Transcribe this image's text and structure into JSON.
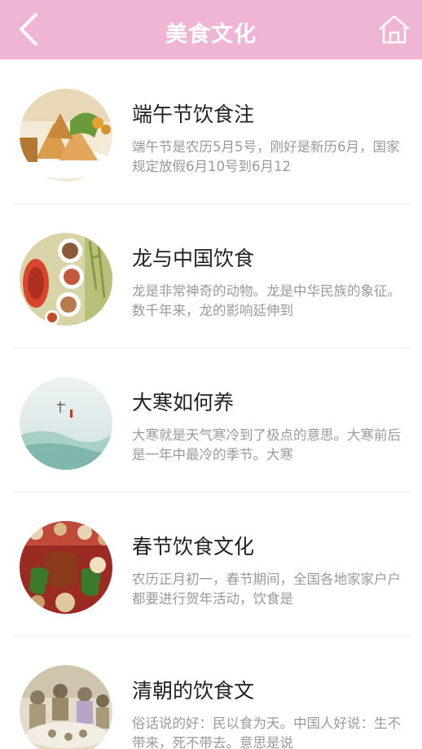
{
  "header": {
    "title": "美食文化",
    "back_icon": "chevron-left-icon",
    "home_icon": "home-icon",
    "background": "#f0b4d4"
  },
  "articles": [
    {
      "title": "端午节饮食注",
      "description": "端午节是农历5月5号，刚好是新历6月，国家规定放假6月10号到6月12",
      "thumbnail": "zongzi-food-photo"
    },
    {
      "title": "龙与中国饮食",
      "description": "龙是非常神奇的动物。龙是中华民族的象征。数千年来，龙的影响延伸到",
      "thumbnail": "dishes-photo"
    },
    {
      "title": "大寒如何养",
      "description": "大寒就是天气寒冷到了极点的意思。大寒前后是一年中最冷的季节。大寒",
      "thumbnail": "winter-landscape-photo"
    },
    {
      "title": "春节饮食文化",
      "description": "农历正月初一，春节期间，全国各地家家户户都要进行贺年活动，饮食是",
      "thumbnail": "spring-festival-dishes-photo"
    },
    {
      "title": "清朝的饮食文",
      "description": "俗话说的好：民以食为天。中国人好说：生不带来，死不带去。意思是说",
      "thumbnail": "qing-dynasty-dinner-photo"
    }
  ]
}
